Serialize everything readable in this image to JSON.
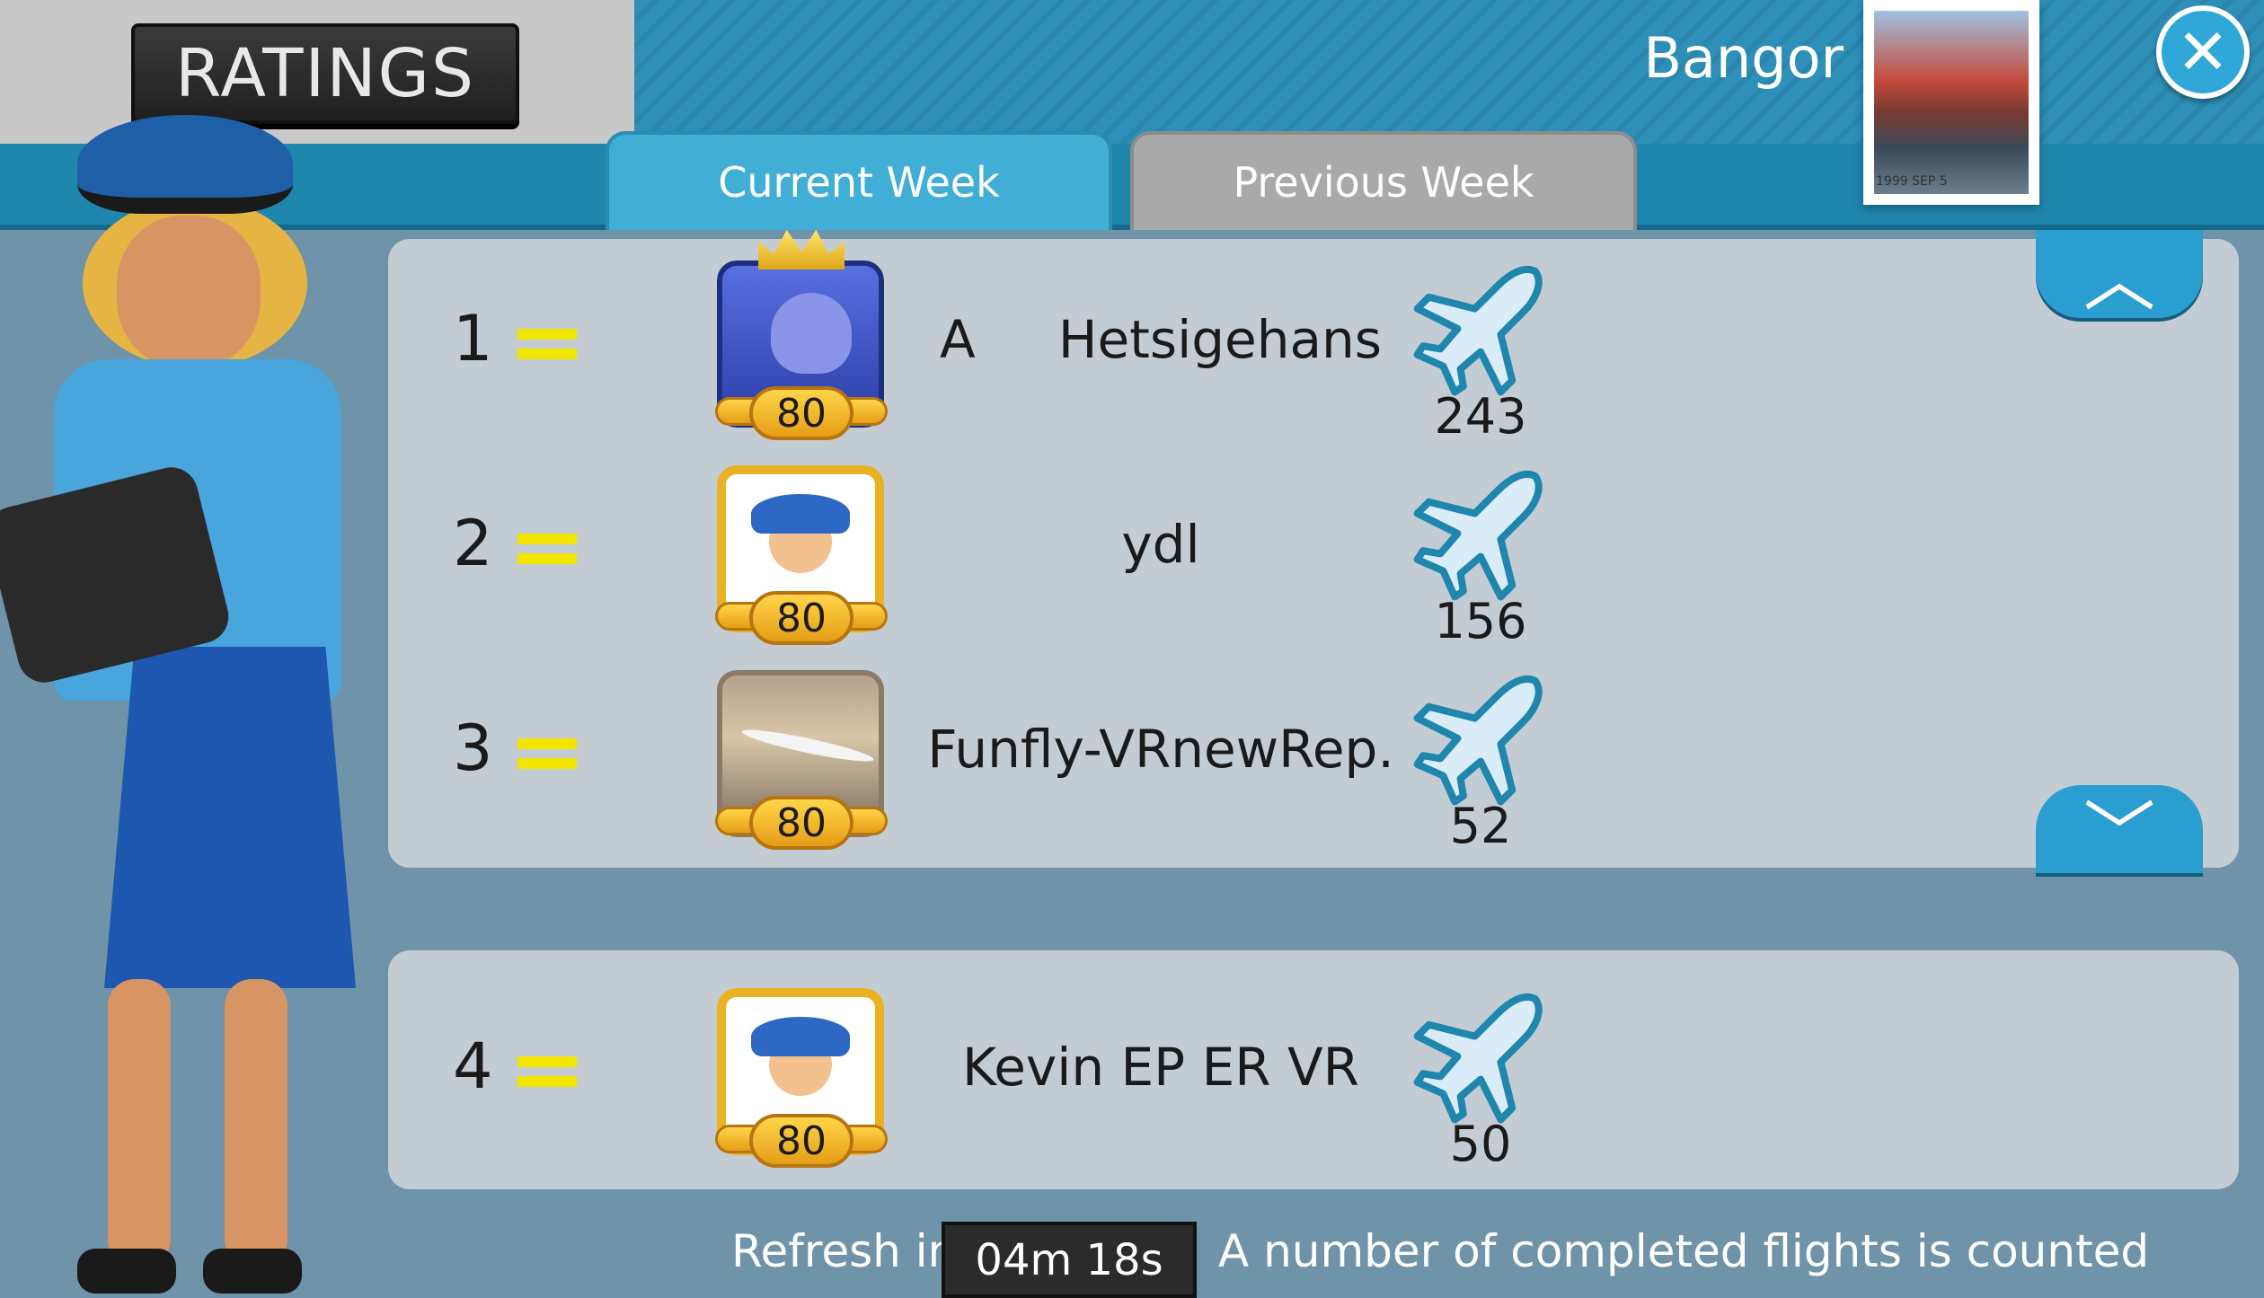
{
  "header": {
    "title": "RATINGS",
    "city": "Bangor",
    "stamp_postmark": "1999 SEP 5"
  },
  "tabs": [
    {
      "label": "Current Week",
      "active": true
    },
    {
      "label": "Previous Week",
      "active": false
    }
  ],
  "leaderboard": [
    {
      "rank": "1",
      "name": "A     Hetsigehans",
      "level": "80",
      "flights": "243",
      "avatar": "shark-crown-avatar"
    },
    {
      "rank": "2",
      "name": "ydl",
      "level": "80",
      "flights": "156",
      "avatar": "pilot-avatar"
    },
    {
      "rank": "3",
      "name": "Funfly-VRnewRep.",
      "level": "80",
      "flights": "52",
      "avatar": "jet-photo-avatar"
    }
  ],
  "own_entry": {
    "rank": "4",
    "name": "Kevin EP ER VR",
    "level": "80",
    "flights": "50",
    "avatar": "pilot-avatar"
  },
  "footer": {
    "refresh_label": "Refresh in",
    "timer": "04m 18s",
    "note": "A number of completed flights is counted"
  },
  "icons": {
    "close": "close-icon",
    "rank_change": "equal-icon",
    "flights": "airplane-icon",
    "scroll_up": "chevron-up-icon",
    "scroll_down": "chevron-down-icon"
  },
  "colors": {
    "accent": "#2a9ed0",
    "tab_active": "#41aed6",
    "tab_inactive": "#a9a9a9",
    "rank_equal": "#f2e600",
    "badge_gold": "#e59e15"
  }
}
